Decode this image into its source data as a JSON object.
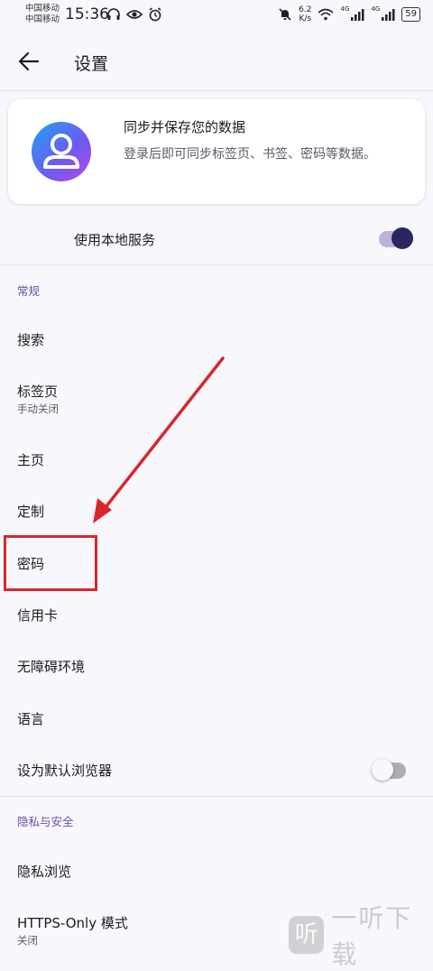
{
  "status_bar": {
    "carrier1": "中国移动",
    "carrier2": "中国移动",
    "time": "15:36",
    "net_speed_value": "6.2",
    "net_speed_unit": "K/s",
    "signal1_label": "4G",
    "signal2_label": "4G",
    "battery": "59"
  },
  "appbar": {
    "title": "设置"
  },
  "account_card": {
    "title": "同步并保存您的数据",
    "subtitle": "登录后即可同步标签页、书签、密码等数据。"
  },
  "local_service": {
    "label": "使用本地服务",
    "enabled": true
  },
  "sections": {
    "general": "常规",
    "privacy": "隐私与安全"
  },
  "general_items": {
    "search": "搜索",
    "tabs": "标签页",
    "tabs_sub": "手动关闭",
    "homepage": "主页",
    "customize": "定制",
    "passwords": "密码",
    "credit_cards": "信用卡",
    "accessibility": "无障碍环境",
    "language": "语言",
    "default_browser": "设为默认浏览器"
  },
  "default_browser_enabled": false,
  "privacy_items": {
    "private_browsing": "隐私浏览",
    "https_only": "HTTPS-Only 模式",
    "https_only_sub": "关闭"
  },
  "watermark": {
    "icon_char": "听",
    "text": "一听下载"
  },
  "colors": {
    "accent": "#6b4fa8",
    "toggle_on_knob": "#2a2760",
    "annotation_red": "#d9262c"
  }
}
